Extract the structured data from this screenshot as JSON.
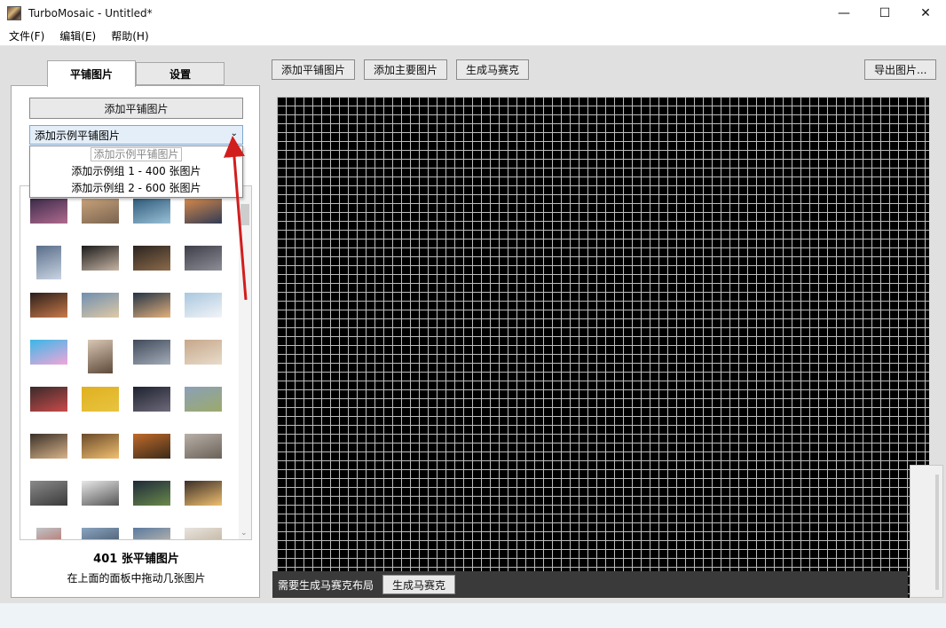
{
  "window": {
    "title": "TurboMosaic - Untitled*",
    "minimize": "—",
    "maximize": "☐",
    "close": "✕"
  },
  "menu": [
    {
      "label": "文件(F)"
    },
    {
      "label": "编辑(E)"
    },
    {
      "label": "帮助(H)"
    }
  ],
  "tabs": {
    "tiles": "平铺图片",
    "settings": "设置"
  },
  "left": {
    "add_tiles_button": "添加平铺图片",
    "combo_value": "添加示例平铺图片",
    "dropdown": [
      "添加示例平铺图片",
      "添加示例组 1 -  400 张图片",
      "添加示例组 2 -  600 张图片"
    ],
    "count_label": "401 张平铺图片",
    "hint_label": "在上面的面板中拖动几张图片"
  },
  "toolbar": {
    "add_tiles": "添加平铺图片",
    "add_main": "添加主要图片",
    "generate": "生成马赛克",
    "export": "导出图片..."
  },
  "status": {
    "text": "需要生成马赛克布局",
    "button": "生成马赛克"
  }
}
